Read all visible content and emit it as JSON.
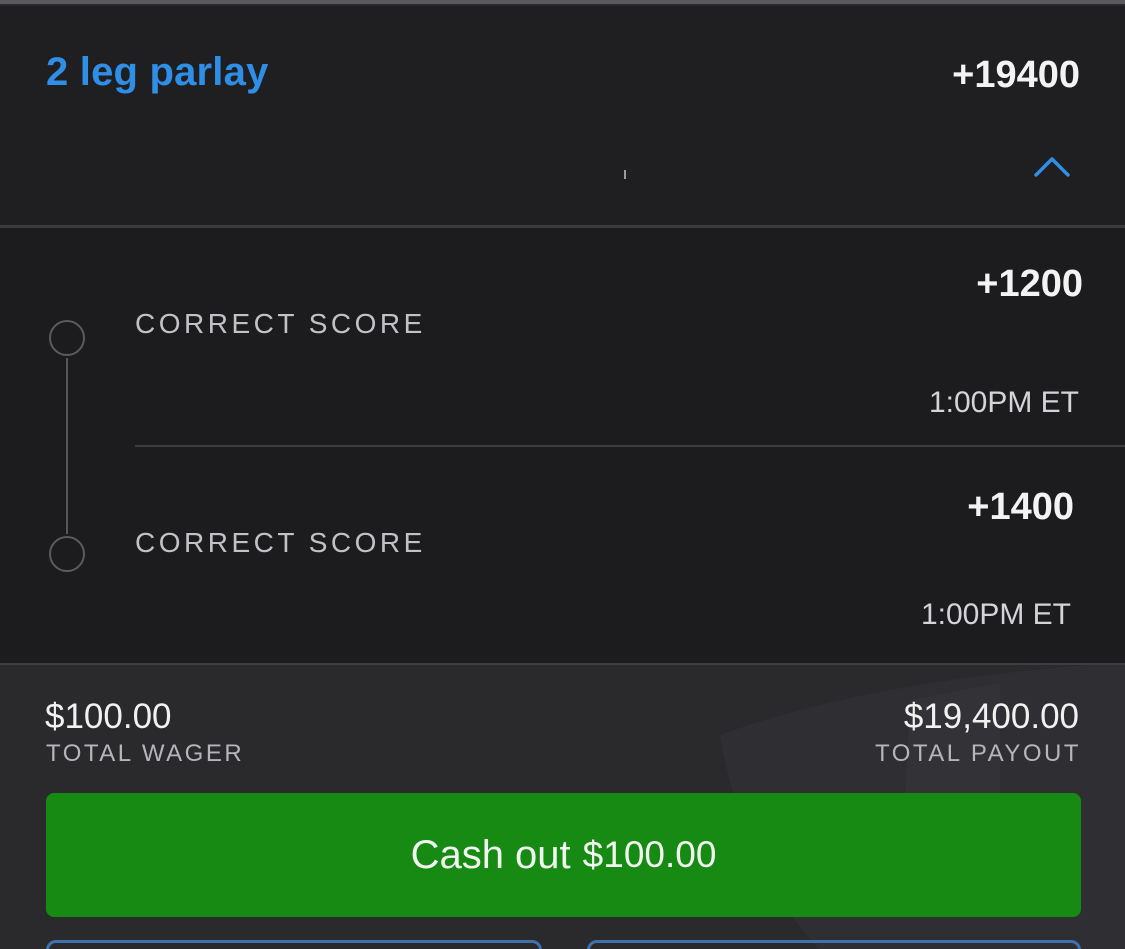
{
  "parlay": {
    "title": "2 leg parlay",
    "odds": "+19400",
    "toggle_icon": "chevron-up-icon"
  },
  "legs": [
    {
      "market": "CORRECT SCORE",
      "odds": "+1200",
      "time": "1:00PM ET"
    },
    {
      "market": "CORRECT SCORE",
      "odds": "+1400",
      "time": "1:00PM ET"
    }
  ],
  "summary": {
    "wager_amount": "$100.00",
    "wager_label": "TOTAL WAGER",
    "payout_amount": "$19,400.00",
    "payout_label": "TOTAL PAYOUT"
  },
  "cashout": {
    "label": "Cash out",
    "amount": "$100.00"
  },
  "colors": {
    "title_blue": "#2f8fe6",
    "cashout_green": "#178a13",
    "background": "#1c1c1e",
    "footer_background": "#2a2a2d",
    "outline_blue": "#3f72ad"
  }
}
